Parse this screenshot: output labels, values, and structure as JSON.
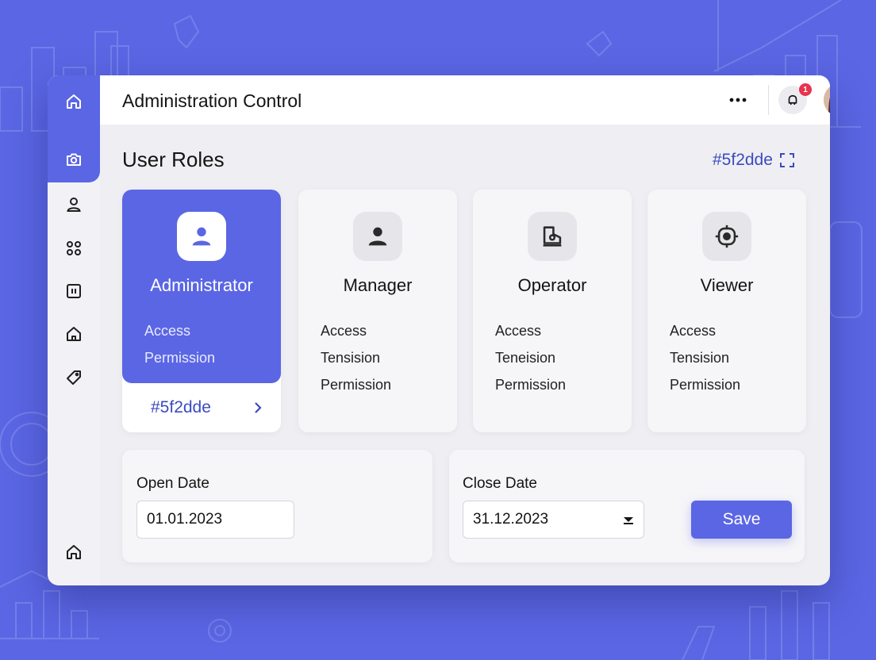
{
  "header": {
    "title": "Administration Control",
    "notification_count": "1"
  },
  "section": {
    "title": "User Roles",
    "color_code": "#5f2dde"
  },
  "roles": [
    {
      "name": "Administrator",
      "permissions": [
        "Access",
        "Permission"
      ],
      "footer_code": "#5f2dde",
      "selected": true
    },
    {
      "name": "Manager",
      "permissions": [
        "Access",
        "Tensision",
        "Permission"
      ]
    },
    {
      "name": "Operator",
      "permissions": [
        "Access",
        "Teneision",
        "Permission"
      ]
    },
    {
      "name": "Viewer",
      "permissions": [
        "Access",
        "Tensision",
        "Permission"
      ]
    }
  ],
  "dates": {
    "open_label": "Open Date",
    "open_value": "01.01.2023",
    "close_label": "Close Date",
    "close_value": "31.12.2023"
  },
  "save_label": "Save",
  "icons": {
    "sidebar": [
      "home-icon",
      "camera-icon",
      "user-icon",
      "apps-icon",
      "pause-icon",
      "lock-home-icon",
      "tag-icon",
      "home-icon"
    ],
    "header": [
      "more-icon",
      "notification-icon",
      "avatar"
    ],
    "roles": [
      "user-icon",
      "user-icon",
      "device-icon",
      "target-icon"
    ]
  },
  "colors": {
    "accent": "#5b66e4",
    "link": "#3b4bbf",
    "badge": "#e8344e"
  }
}
